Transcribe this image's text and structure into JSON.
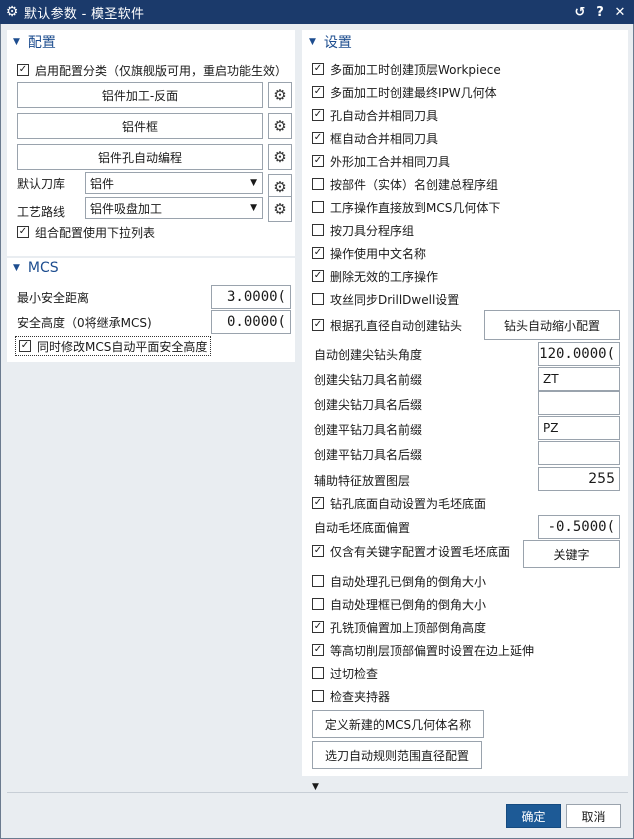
{
  "window": {
    "title": "默认参数 - 模圣软件"
  },
  "config": {
    "header": "配置",
    "enable_category": "启用配置分类（仅旗舰版可用，重启功能生效）",
    "buttons": [
      "铝件加工-反面",
      "铝件框",
      "铝件孔自动编程"
    ],
    "tool_library_label": "默认刀库",
    "tool_library_value": "铝件",
    "process_route_label": "工艺路线",
    "process_route_value": "铝件吸盘加工",
    "combo_dropdown": "组合配置使用下拉列表"
  },
  "mcs": {
    "header": "MCS",
    "min_safe_label": "最小安全距离",
    "min_safe_value": "3.0000(",
    "safe_height_label": "安全高度（0将继承MCS)",
    "safe_height_value": "0.0000(",
    "sync_plane": "同时修改MCS自动平面安全高度"
  },
  "settings": {
    "header": "设置",
    "checks": [
      {
        "label": "多面加工时创建顶层Workpiece",
        "checked": true
      },
      {
        "label": "多面加工时创建最终IPW几何体",
        "checked": true
      },
      {
        "label": "孔自动合并相同刀具",
        "checked": true
      },
      {
        "label": "框自动合并相同刀具",
        "checked": true
      },
      {
        "label": "外形加工合并相同刀具",
        "checked": true
      },
      {
        "label": "按部件（实体）名创建总程序组",
        "checked": false
      },
      {
        "label": "工序操作直接放到MCS几何体下",
        "checked": false
      },
      {
        "label": "按刀具分程序组",
        "checked": false
      },
      {
        "label": "操作使用中文名称",
        "checked": true
      },
      {
        "label": "删除无效的工序操作",
        "checked": true
      },
      {
        "label": "攻丝同步DrillDwell设置",
        "checked": false
      }
    ],
    "auto_drill": {
      "label": "根据孔直径自动创建钻头",
      "checked": true
    },
    "drill_shrink_button": "钻头自动缩小配置",
    "drill_angle_label": "自动创建尖钻头角度",
    "drill_angle_value": "120.0000(",
    "tip_prefix_label": "创建尖钻刀具名前缀",
    "tip_prefix_value": "ZT",
    "tip_suffix_label": "创建尖钻刀具名后缀",
    "tip_suffix_value": "",
    "flat_prefix_label": "创建平钻刀具名前缀",
    "flat_prefix_value": "PZ",
    "flat_suffix_label": "创建平钻刀具名后缀",
    "flat_suffix_value": "",
    "aux_layer_label": "辅助特征放置图层",
    "aux_layer_value": "255",
    "hole_bottom": {
      "label": "钻孔底面自动设置为毛坯底面",
      "checked": true
    },
    "blank_offset_label": "自动毛坯底面偏置",
    "blank_offset_value": "-0.5000(",
    "keyword_only": {
      "label": "仅含有关键字配置才设置毛坯底面",
      "checked": true
    },
    "keyword_button": "关键字",
    "checks2": [
      {
        "label": "自动处理孔已倒角的倒角大小",
        "checked": false
      },
      {
        "label": "自动处理框已倒角的倒角大小",
        "checked": false
      },
      {
        "label": "孔铣顶偏置加上顶部倒角高度",
        "checked": true
      },
      {
        "label": "等高切削层顶部偏置时设置在边上延伸",
        "checked": true
      },
      {
        "label": "过切检查",
        "checked": false
      },
      {
        "label": "检查夹持器",
        "checked": false
      }
    ],
    "define_mcs_button": "定义新建的MCS几何体名称",
    "select_tool_button": "选刀自动规则范围直径配置"
  },
  "footer": {
    "ok": "确定",
    "cancel": "取消"
  },
  "colors": {
    "title_bg": "#1b3a6b",
    "accent": "#1d5a96",
    "panel": "#ffffff"
  }
}
